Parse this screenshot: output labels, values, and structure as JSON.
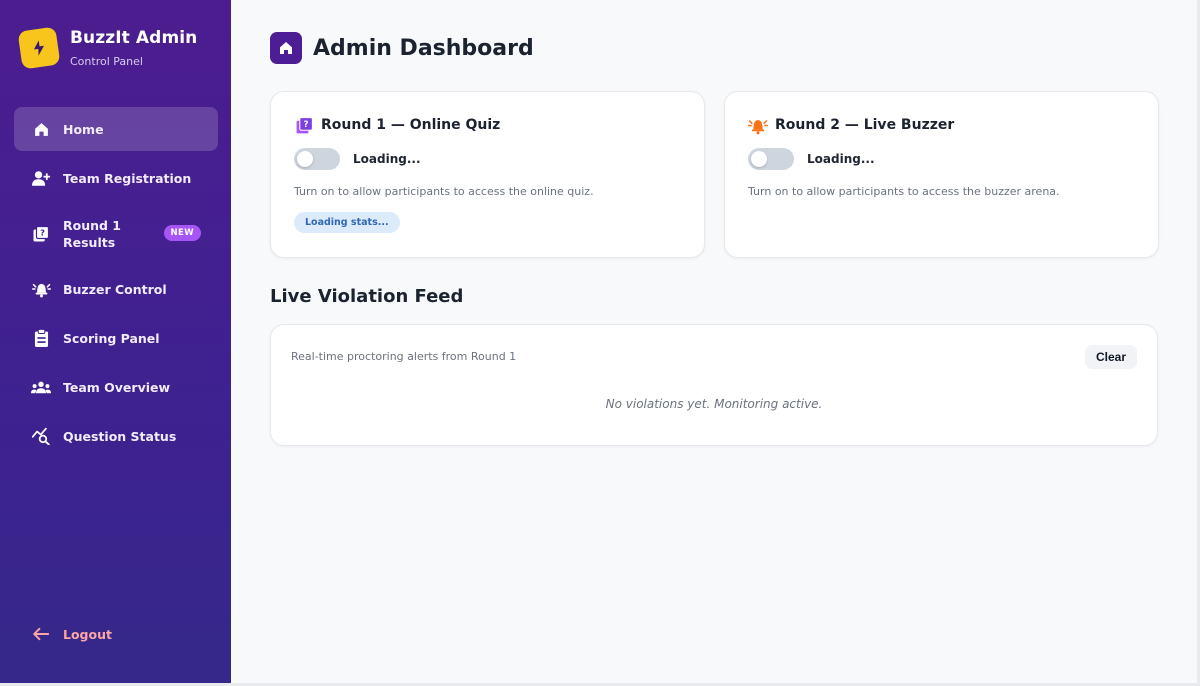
{
  "brand": {
    "title": "BuzzIt Admin",
    "subtitle": "Control Panel"
  },
  "sidebar": {
    "items": [
      {
        "label": "Home",
        "icon": "home-icon",
        "active": true
      },
      {
        "label": "Team Registration",
        "icon": "user-plus-icon"
      },
      {
        "label": "Round 1 Results",
        "icon": "quiz-stack-icon",
        "badge": "NEW"
      },
      {
        "label": "Buzzer Control",
        "icon": "bell-icon"
      },
      {
        "label": "Scoring Panel",
        "icon": "clipboard-icon"
      },
      {
        "label": "Team Overview",
        "icon": "users-icon"
      },
      {
        "label": "Question Status",
        "icon": "chart-search-icon"
      }
    ],
    "logout_label": "Logout"
  },
  "page": {
    "title": "Admin Dashboard"
  },
  "round1": {
    "title": "Round 1 — Online Quiz",
    "toggle_label": "Loading...",
    "toggle_on": false,
    "description": "Turn on to allow participants to access the online quiz.",
    "stats_label": "Loading stats..."
  },
  "round2": {
    "title": "Round 2 — Live Buzzer",
    "toggle_label": "Loading...",
    "toggle_on": false,
    "description": "Turn on to allow participants to access the buzzer arena."
  },
  "feed": {
    "title": "Live Violation Feed",
    "subtitle": "Real-time proctoring alerts from Round 1",
    "clear_label": "Clear",
    "empty_message": "No violations yet. Monitoring active."
  },
  "colors": {
    "sidebar_top": "#4c1d8f",
    "sidebar_bottom": "#35288a",
    "brand_logo": "#f8c51c",
    "badge": "#a855f7",
    "logout": "#fca5a5",
    "bell_accent": "#f97316"
  }
}
